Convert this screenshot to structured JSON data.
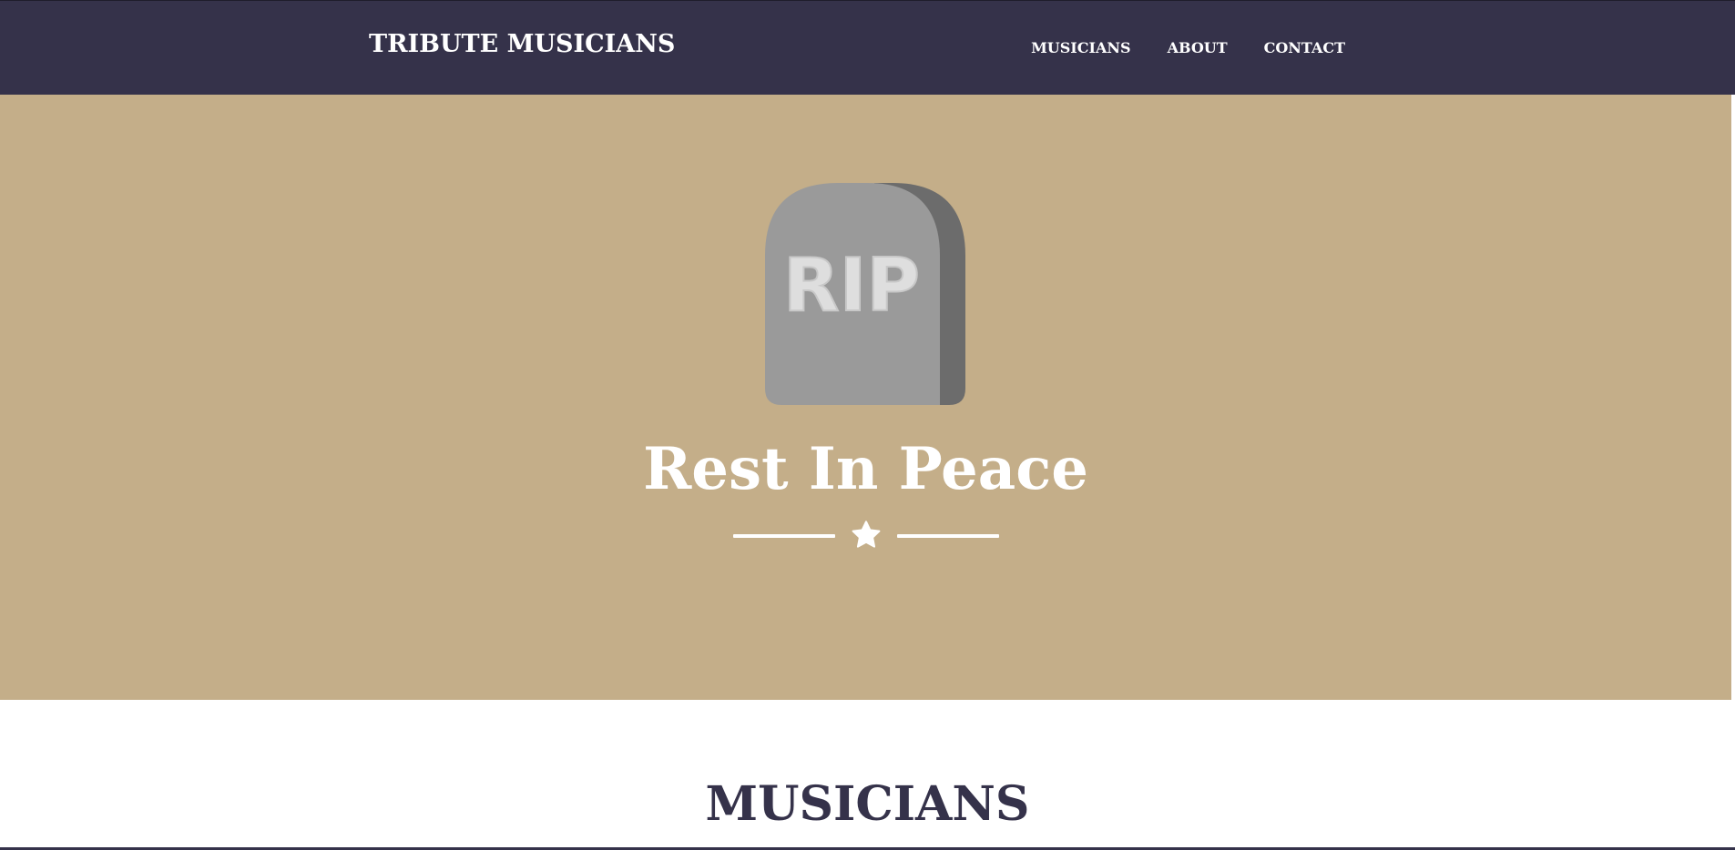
{
  "navbar": {
    "brand": "TRIBUTE MUSICIANS",
    "links": [
      "MUSICIANS",
      "ABOUT",
      "CONTACT"
    ]
  },
  "hero": {
    "image_text": "RIP",
    "title": "Rest In Peace",
    "divider_icon": "star-icon"
  },
  "section": {
    "title": "MUSICIANS"
  },
  "colors": {
    "navbar": "#35324a",
    "hero": "#c4ae89",
    "text_light": "#ffffff",
    "section_heading": "#35324a",
    "tombstone": "#9a9a9a",
    "tombstone_shadow": "#6c6c6c"
  }
}
